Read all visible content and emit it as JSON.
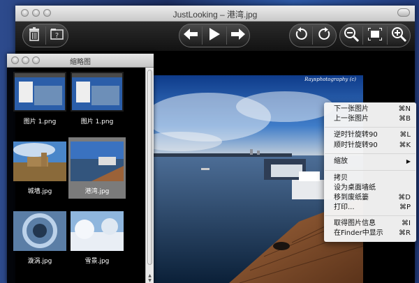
{
  "window": {
    "title": "JustLooking – 港湾.jpg"
  },
  "toolbar": {
    "buttons": [
      {
        "name": "trash-icon"
      },
      {
        "name": "info-icon"
      },
      {
        "name": "previous-arrow-icon"
      },
      {
        "name": "play-icon"
      },
      {
        "name": "next-arrow-icon"
      },
      {
        "name": "rotate-left-icon"
      },
      {
        "name": "rotate-right-icon"
      },
      {
        "name": "zoom-out-icon"
      },
      {
        "name": "fit-screen-icon"
      },
      {
        "name": "zoom-in-icon"
      }
    ]
  },
  "photo": {
    "watermark": "Raysphotography (c)"
  },
  "thumbnails": {
    "title": "缩略图",
    "items": [
      {
        "label": "图片 1.png",
        "selected": false
      },
      {
        "label": "图片 1.png",
        "selected": false
      },
      {
        "label": "城墙.jpg",
        "selected": false
      },
      {
        "label": "港湾.jpg",
        "selected": true
      },
      {
        "label": "漩涡.jpg",
        "selected": false
      },
      {
        "label": "雪景.jpg",
        "selected": false
      }
    ]
  },
  "context_menu": {
    "items": [
      {
        "label": "下一张图片",
        "shortcut": "⌘N"
      },
      {
        "label": "上一张图片",
        "shortcut": "⌘B"
      },
      {
        "label": "逆时针旋转90",
        "shortcut": "⌘L"
      },
      {
        "label": "顺时针旋转90",
        "shortcut": "⌘K"
      },
      {
        "label": "缩放",
        "shortcut": "▶"
      },
      {
        "label": "拷贝",
        "shortcut": ""
      },
      {
        "label": "设为桌面墙纸",
        "shortcut": ""
      },
      {
        "label": "移到废纸篓",
        "shortcut": "⌘D"
      },
      {
        "label": "打印...",
        "shortcut": "⌘P"
      },
      {
        "label": "取得图片信息",
        "shortcut": "⌘I"
      },
      {
        "label": "在Finder中显示",
        "shortcut": "⌘R"
      }
    ]
  }
}
